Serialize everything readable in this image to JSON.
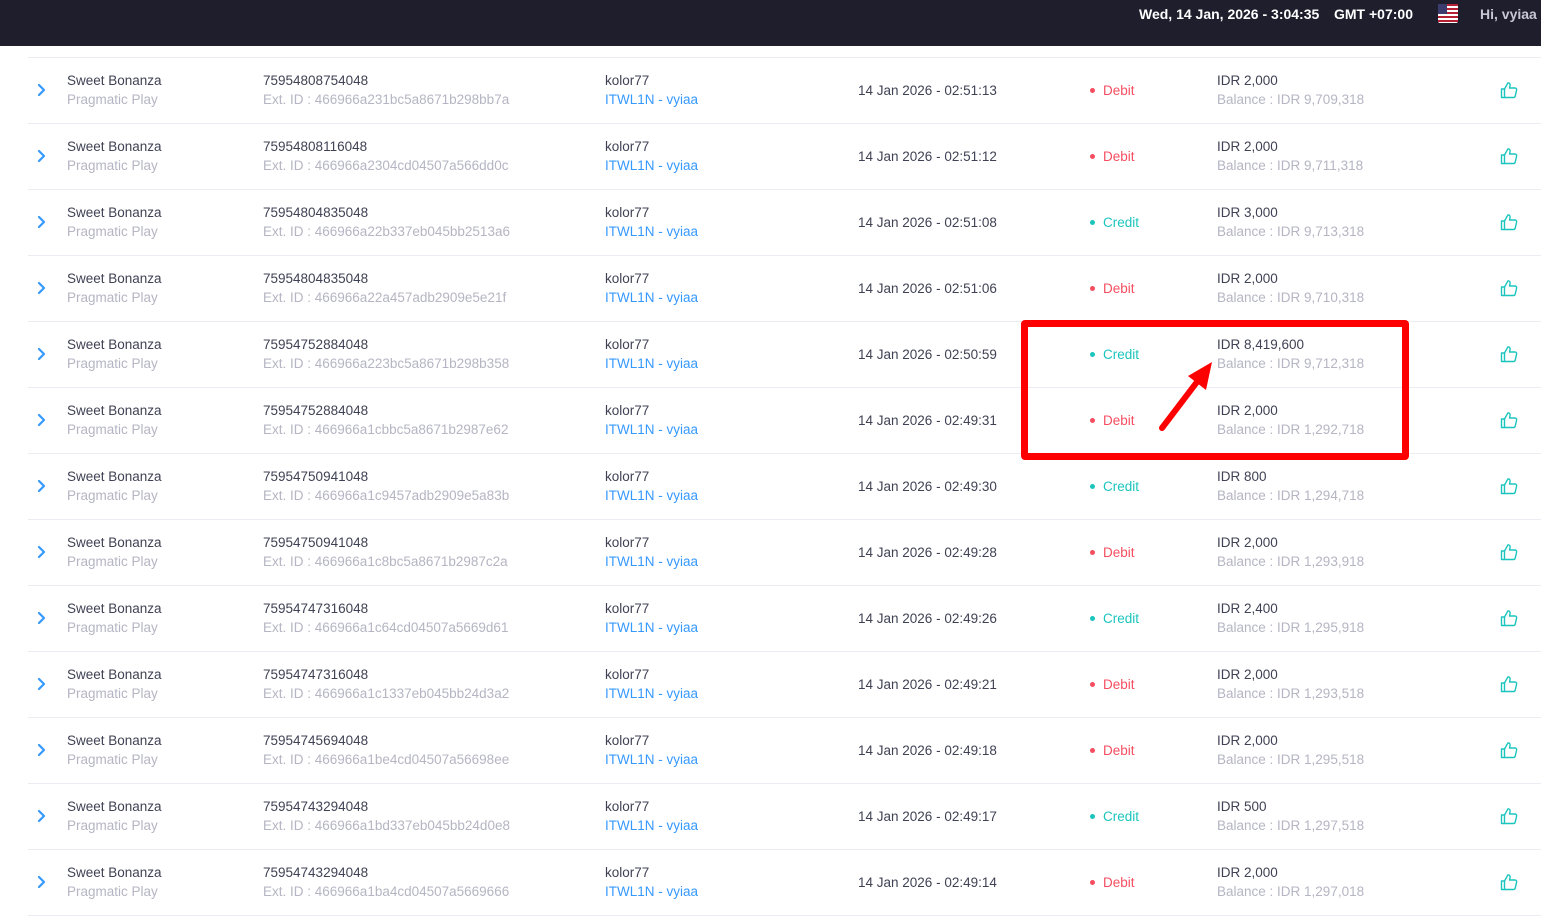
{
  "header": {
    "datetime": "Wed, 14 Jan, 2026 - 3:04:35",
    "timezone": "GMT +07:00",
    "greeting": "Hi, vyiaa"
  },
  "colors": {
    "debit": "#f64e60",
    "credit": "#1bc5bd",
    "link": "#3699ff",
    "annotation": "#ff0000"
  },
  "transactions": [
    {
      "game": "Sweet Bonanza",
      "provider": "Pragmatic Play",
      "id": "75954808754048",
      "ext_id": "Ext. ID : 466966a231bc5a8671b298bb7a",
      "user": "kolor77",
      "agent": "ITWL1N - vyiaa",
      "date": "14 Jan 2026 - 02:51:13",
      "type": "Debit",
      "amount": "IDR 2,000",
      "balance": "Balance : IDR 9,709,318"
    },
    {
      "game": "Sweet Bonanza",
      "provider": "Pragmatic Play",
      "id": "75954808116048",
      "ext_id": "Ext. ID : 466966a2304cd04507a566dd0c",
      "user": "kolor77",
      "agent": "ITWL1N - vyiaa",
      "date": "14 Jan 2026 - 02:51:12",
      "type": "Debit",
      "amount": "IDR 2,000",
      "balance": "Balance : IDR 9,711,318"
    },
    {
      "game": "Sweet Bonanza",
      "provider": "Pragmatic Play",
      "id": "75954804835048",
      "ext_id": "Ext. ID : 466966a22b337eb045bb2513a6",
      "user": "kolor77",
      "agent": "ITWL1N - vyiaa",
      "date": "14 Jan 2026 - 02:51:08",
      "type": "Credit",
      "amount": "IDR 3,000",
      "balance": "Balance : IDR 9,713,318"
    },
    {
      "game": "Sweet Bonanza",
      "provider": "Pragmatic Play",
      "id": "75954804835048",
      "ext_id": "Ext. ID : 466966a22a457adb2909e5e21f",
      "user": "kolor77",
      "agent": "ITWL1N - vyiaa",
      "date": "14 Jan 2026 - 02:51:06",
      "type": "Debit",
      "amount": "IDR 2,000",
      "balance": "Balance : IDR 9,710,318"
    },
    {
      "game": "Sweet Bonanza",
      "provider": "Pragmatic Play",
      "id": "75954752884048",
      "ext_id": "Ext. ID : 466966a223bc5a8671b298b358",
      "user": "kolor77",
      "agent": "ITWL1N - vyiaa",
      "date": "14 Jan 2026 - 02:50:59",
      "type": "Credit",
      "amount": "IDR 8,419,600",
      "balance": "Balance : IDR 9,712,318"
    },
    {
      "game": "Sweet Bonanza",
      "provider": "Pragmatic Play",
      "id": "75954752884048",
      "ext_id": "Ext. ID : 466966a1cbbc5a8671b2987e62",
      "user": "kolor77",
      "agent": "ITWL1N - vyiaa",
      "date": "14 Jan 2026 - 02:49:31",
      "type": "Debit",
      "amount": "IDR 2,000",
      "balance": "Balance : IDR 1,292,718"
    },
    {
      "game": "Sweet Bonanza",
      "provider": "Pragmatic Play",
      "id": "75954750941048",
      "ext_id": "Ext. ID : 466966a1c9457adb2909e5a83b",
      "user": "kolor77",
      "agent": "ITWL1N - vyiaa",
      "date": "14 Jan 2026 - 02:49:30",
      "type": "Credit",
      "amount": "IDR 800",
      "balance": "Balance : IDR 1,294,718"
    },
    {
      "game": "Sweet Bonanza",
      "provider": "Pragmatic Play",
      "id": "75954750941048",
      "ext_id": "Ext. ID : 466966a1c8bc5a8671b2987c2a",
      "user": "kolor77",
      "agent": "ITWL1N - vyiaa",
      "date": "14 Jan 2026 - 02:49:28",
      "type": "Debit",
      "amount": "IDR 2,000",
      "balance": "Balance : IDR 1,293,918"
    },
    {
      "game": "Sweet Bonanza",
      "provider": "Pragmatic Play",
      "id": "75954747316048",
      "ext_id": "Ext. ID : 466966a1c64cd04507a5669d61",
      "user": "kolor77",
      "agent": "ITWL1N - vyiaa",
      "date": "14 Jan 2026 - 02:49:26",
      "type": "Credit",
      "amount": "IDR 2,400",
      "balance": "Balance : IDR 1,295,918"
    },
    {
      "game": "Sweet Bonanza",
      "provider": "Pragmatic Play",
      "id": "75954747316048",
      "ext_id": "Ext. ID : 466966a1c1337eb045bb24d3a2",
      "user": "kolor77",
      "agent": "ITWL1N - vyiaa",
      "date": "14 Jan 2026 - 02:49:21",
      "type": "Debit",
      "amount": "IDR 2,000",
      "balance": "Balance : IDR 1,293,518"
    },
    {
      "game": "Sweet Bonanza",
      "provider": "Pragmatic Play",
      "id": "75954745694048",
      "ext_id": "Ext. ID : 466966a1be4cd04507a56698ee",
      "user": "kolor77",
      "agent": "ITWL1N - vyiaa",
      "date": "14 Jan 2026 - 02:49:18",
      "type": "Debit",
      "amount": "IDR 2,000",
      "balance": "Balance : IDR 1,295,518"
    },
    {
      "game": "Sweet Bonanza",
      "provider": "Pragmatic Play",
      "id": "75954743294048",
      "ext_id": "Ext. ID : 466966a1bd337eb045bb24d0e8",
      "user": "kolor77",
      "agent": "ITWL1N - vyiaa",
      "date": "14 Jan 2026 - 02:49:17",
      "type": "Credit",
      "amount": "IDR 500",
      "balance": "Balance : IDR 1,297,518"
    },
    {
      "game": "Sweet Bonanza",
      "provider": "Pragmatic Play",
      "id": "75954743294048",
      "ext_id": "Ext. ID : 466966a1ba4cd04507a5669666",
      "user": "kolor77",
      "agent": "ITWL1N - vyiaa",
      "date": "14 Jan 2026 - 02:49:14",
      "type": "Debit",
      "amount": "IDR 2,000",
      "balance": "Balance : IDR 1,297,018"
    }
  ]
}
